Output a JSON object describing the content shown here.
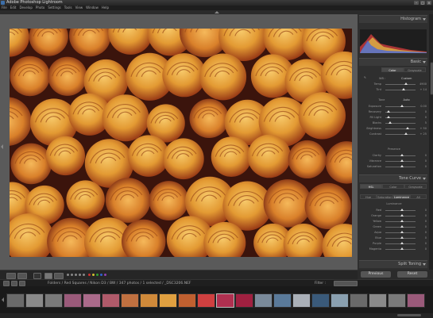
{
  "window": {
    "title": "Adobe Photoshop Lightroom"
  },
  "menu": [
    "File",
    "Edit",
    "Develop",
    "Photo",
    "Settings",
    "Tools",
    "View",
    "Window",
    "Help"
  ],
  "right_panel": {
    "histogram_label": "Histogram",
    "basic_label": "Basic",
    "basic_tabs": [
      "Color",
      "Grayscale"
    ],
    "wb_label": "WB :",
    "wb_value": "Custom",
    "wb_sliders": [
      {
        "label": "Temp",
        "value": "4900"
      },
      {
        "label": "Tint",
        "value": "+ 14"
      }
    ],
    "tone_label": "Tone",
    "tone_auto": "Auto",
    "tone_sliders": [
      {
        "label": "Exposure",
        "value": "0.00"
      },
      {
        "label": "Recovery",
        "value": "0"
      },
      {
        "label": "Fill Light",
        "value": "0"
      },
      {
        "label": "Blacks",
        "value": "5"
      },
      {
        "label": "Brightness",
        "value": "+ 50"
      },
      {
        "label": "Contrast",
        "value": "+ 25"
      }
    ],
    "presence_label": "Presence",
    "presence_sliders": [
      {
        "label": "Clarity",
        "value": "0"
      },
      {
        "label": "Vibrance",
        "value": "0"
      },
      {
        "label": "Saturation",
        "value": "0"
      }
    ],
    "tone_curve_label": "Tone Curve",
    "hsl_tabs": [
      "HSL",
      "Color",
      "Grayscale"
    ],
    "hsl_subtabs": [
      "Hue",
      "Saturation",
      "Luminance",
      "All"
    ],
    "luminance_label": "Luminance",
    "hsl_sliders": [
      {
        "label": "Red",
        "value": "0"
      },
      {
        "label": "Orange",
        "value": "0"
      },
      {
        "label": "Yellow",
        "value": "0"
      },
      {
        "label": "Green",
        "value": "0"
      },
      {
        "label": "Aqua",
        "value": "0"
      },
      {
        "label": "Blue",
        "value": "0"
      },
      {
        "label": "Purple",
        "value": "0"
      },
      {
        "label": "Magenta",
        "value": "0"
      }
    ],
    "split_toning_label": "Split Toning",
    "previous_button": "Previous",
    "reset_button": "Reset"
  },
  "filmstrip": {
    "breadcrumb": "Folders / Red Squares / Nikon D3 / BW / 347 photos / 1 selected / _DSC3206.NEF",
    "filter_label": "Filter :"
  },
  "colors": {
    "accent": "#3c6ea8",
    "rose_primary": "#e8a23a",
    "rose_shadow": "#8a3a16"
  }
}
